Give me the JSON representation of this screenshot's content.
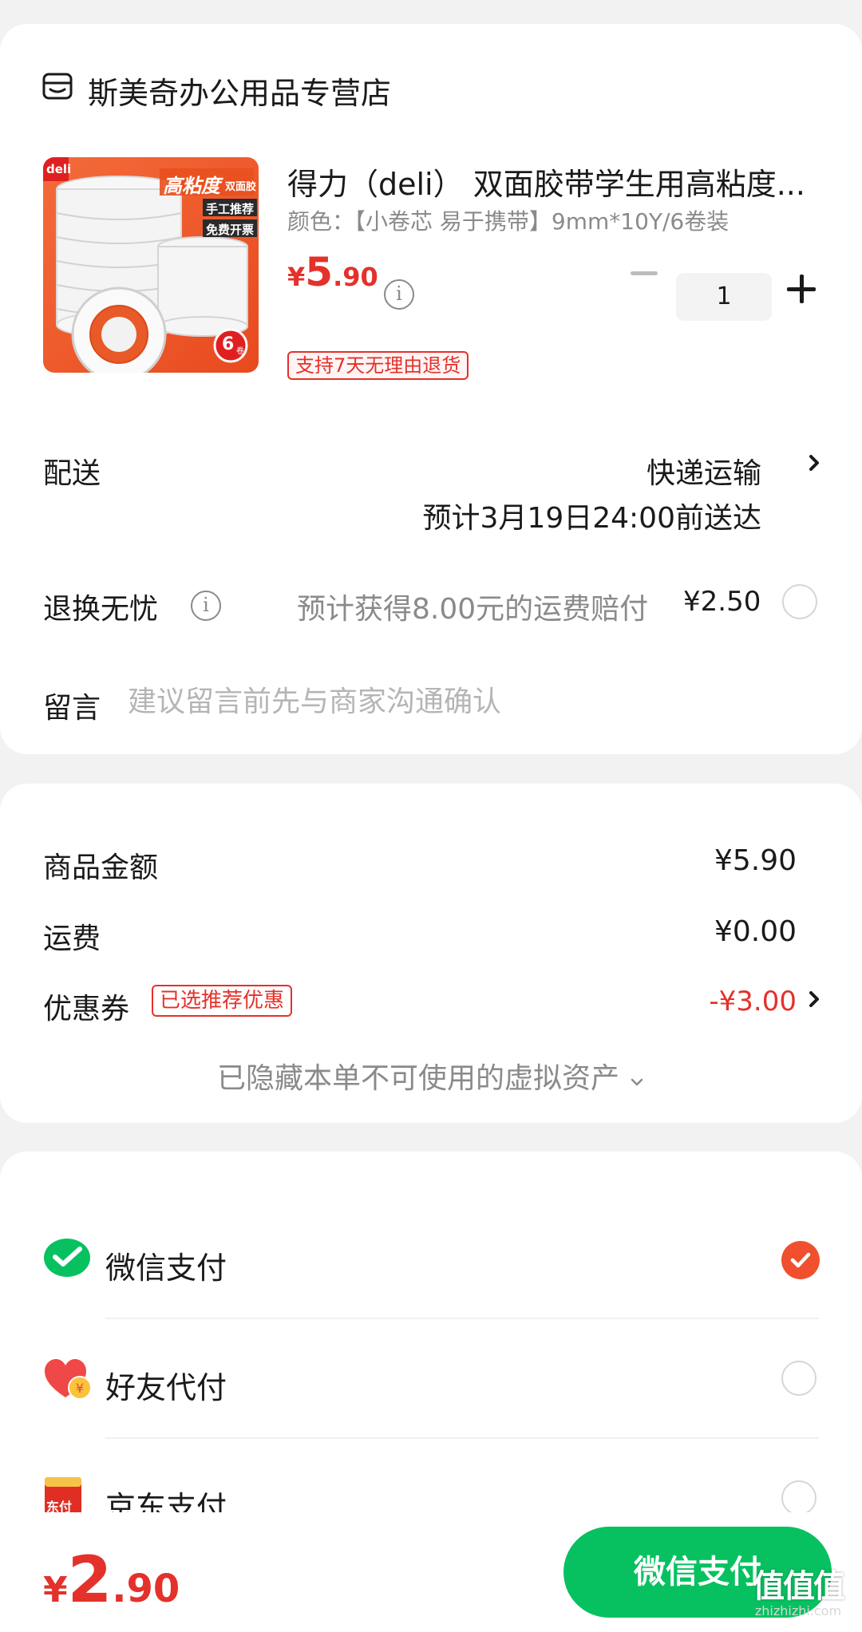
{
  "shop": {
    "name": "斯美奇办公用品专营店",
    "icon": "store-icon"
  },
  "product": {
    "brand_badge": "deli",
    "image_text_main": "高粘度",
    "image_text_sub": "双面胶",
    "image_tag_1": "手工推荐",
    "image_tag_2": "免费开票",
    "image_count": "6",
    "image_count_unit": "卷",
    "title": "得力（deli） 双面胶带学生用高粘度...",
    "spec": "颜色：【小卷芯 易于携带】9mm*10Y/6卷装",
    "price_currency": "¥",
    "price_int": "5",
    "price_dec": ".90",
    "quantity": "1",
    "return_tag": "支持7天无理由退货"
  },
  "shipping": {
    "label": "配送",
    "method": "快递运输",
    "eta": "预计3月19日24:00前送达"
  },
  "return_service": {
    "label": "退换无忧",
    "desc": "预计获得8.00元的运费赔付",
    "price": "¥2.50"
  },
  "message": {
    "label": "留言",
    "placeholder": "建议留言前先与商家沟通确认"
  },
  "summary": {
    "goods_label": "商品金额",
    "goods_value": "¥5.90",
    "freight_label": "运费",
    "freight_value": "¥0.00",
    "coupon_label": "优惠券",
    "coupon_tag": "已选推荐优惠",
    "coupon_value": "-¥3.00",
    "hidden_assets": "已隐藏本单不可使用的虚拟资产"
  },
  "payment_methods": [
    {
      "label": "微信支付",
      "icon": "wechat-pay-icon",
      "selected": true
    },
    {
      "label": "好友代付",
      "icon": "friend-pay-icon",
      "selected": false
    },
    {
      "label": "京东支付",
      "icon": "jd-pay-icon",
      "selected": false,
      "icon_text": "东付"
    }
  ],
  "bottom": {
    "total_currency": "¥",
    "total_int": "2",
    "total_dec": ".90",
    "pay_button": "微信支付",
    "watermark_mark": "值值值",
    "watermark_url": "zhizhizhi.com"
  },
  "colors": {
    "price_red": "#e4312b",
    "wechat_green": "#07c160",
    "check_orange": "#f0502d"
  }
}
